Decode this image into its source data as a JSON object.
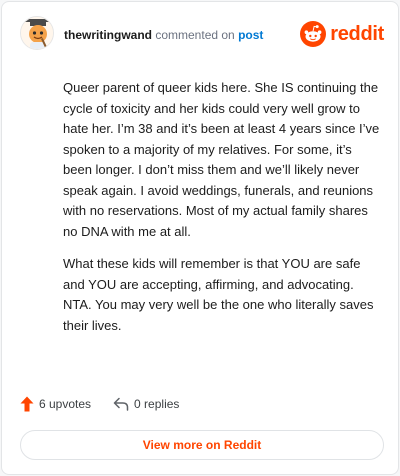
{
  "comment": {
    "username": "thewritingwand",
    "action_text": "commented on",
    "target_link": "post",
    "paragraphs": [
      "Queer parent of queer kids here. She IS continuing the cycle of toxicity and her kids could very well grow to hate her. I’m 38 and it’s been at least 4 years since I’ve spoken to a majority of my relatives. For some, it’s been longer. I don’t miss them and we’ll likely never speak again. I avoid weddings, funerals, and reunions with no reservations. Most of my actual family shares no DNA with me at all.",
      "What these kids will remember is that YOU are safe and YOU are accepting, affirming, and advocating. NTA. You may very well be the one who literally saves their lives."
    ]
  },
  "brand": {
    "name": "reddit",
    "icon": "reddit-snoo-icon",
    "color": "#ff4500"
  },
  "actions": {
    "upvotes_label": "6 upvotes",
    "upvote_icon": "upvote-arrow-icon",
    "replies_label": "0 replies",
    "reply_icon": "reply-icon"
  },
  "footer": {
    "view_more_label": "View more on Reddit"
  },
  "colors": {
    "accent": "#ff4500",
    "link": "#0079d3",
    "text": "#1c1c1c",
    "muted": "#6b7280"
  }
}
